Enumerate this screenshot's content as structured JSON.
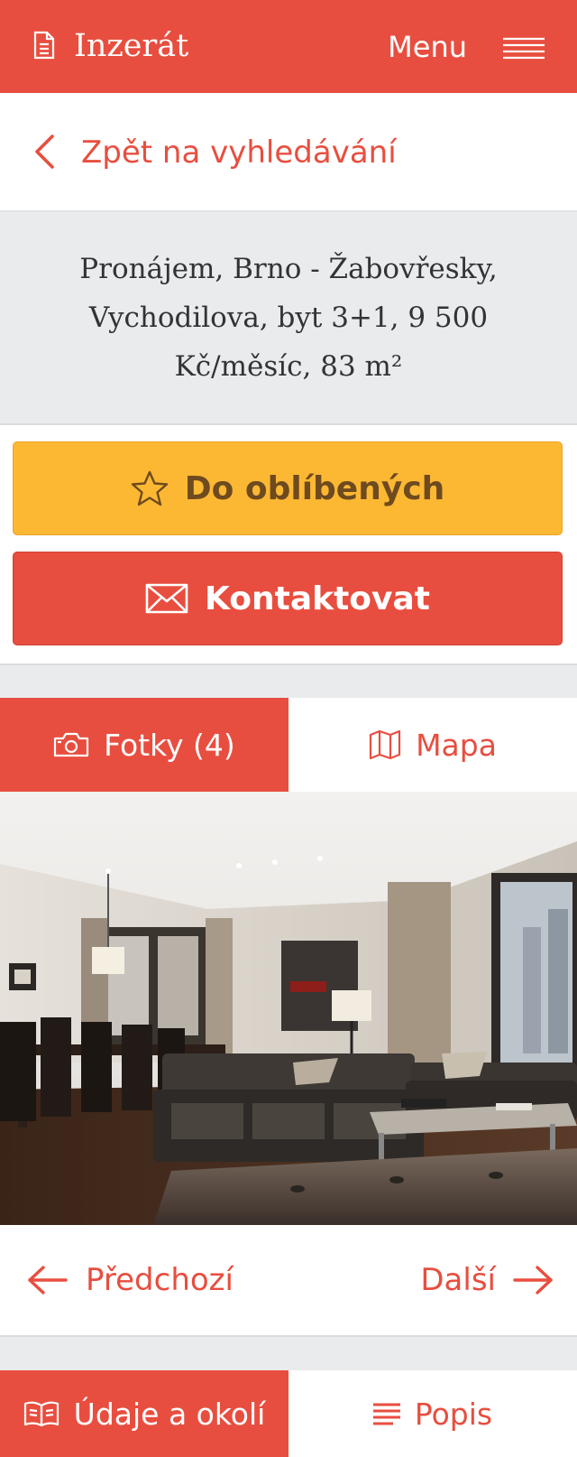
{
  "header": {
    "title": "Inzerát",
    "menu_label": "Menu",
    "icons": {
      "title": "document-icon",
      "menu": "hamburger-icon"
    }
  },
  "back": {
    "label": "Zpět na vyhledávání",
    "icon": "chevron-left-icon"
  },
  "listing": {
    "title": "Pronájem, Brno - Žabovřesky, Vychodilova, byt 3+1, 9 500 Kč/měsíc, 83 m²"
  },
  "actions": {
    "favorite_label": "Do oblíbených",
    "contact_label": "Kontaktovat"
  },
  "media_tabs": [
    {
      "label": "Fotky (4)",
      "icon": "camera-icon",
      "active": true
    },
    {
      "label": "Mapa",
      "icon": "map-icon",
      "active": false
    }
  ],
  "pager": {
    "prev_label": "Předchozí",
    "next_label": "Další"
  },
  "info_tabs": [
    {
      "label": "Údaje a okolí",
      "icon": "book-icon",
      "active": true
    },
    {
      "label": "Popis",
      "icon": "list-icon",
      "active": false
    }
  ],
  "colors": {
    "brand": "#e84e3f",
    "favorite": "#fdb833",
    "favorite_text": "#6e4a1f",
    "panel_bg": "#e9ebed"
  }
}
